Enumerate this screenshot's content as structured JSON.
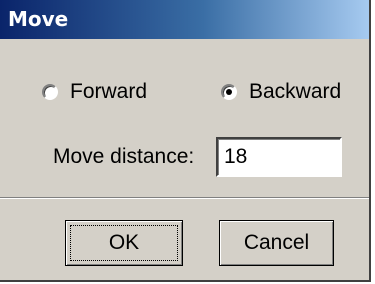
{
  "window": {
    "title": "Move"
  },
  "direction": {
    "options": [
      {
        "label": "Forward",
        "selected": false
      },
      {
        "label": "Backward",
        "selected": true
      }
    ]
  },
  "move_distance": {
    "label": "Move distance:",
    "value": "18"
  },
  "buttons": {
    "ok_label": "OK",
    "cancel_label": "Cancel"
  },
  "colors": {
    "face": "#d4d0c8",
    "title_start": "#0a246a",
    "title_end": "#a6caf0"
  }
}
